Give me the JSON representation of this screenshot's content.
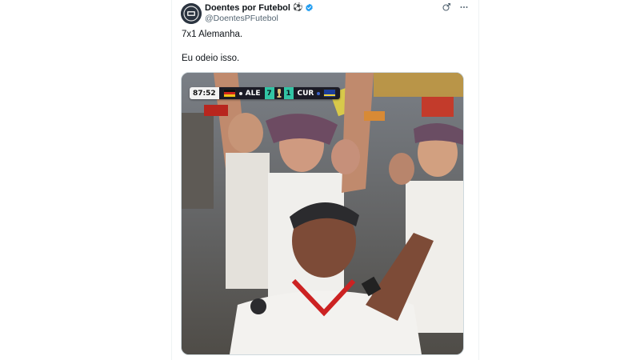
{
  "tweet": {
    "author": {
      "display_name": "Doentes por Futebol",
      "handle": "@DoentesPFutebol",
      "verified": true,
      "name_emoji": "⚽"
    },
    "text_line1": "7x1 Alemanha.",
    "text_line2": "Eu odeio isso.",
    "media": {
      "score_bug": {
        "clock": "87:52",
        "home_team": "ALE",
        "home_score": "7",
        "away_score": "1",
        "away_team": "CUR"
      }
    }
  },
  "colors": {
    "verified_blue": "#1d9bf0",
    "score_green": "#32c4a4",
    "text_primary": "#0f1419",
    "text_secondary": "#536471"
  },
  "icons": {
    "grok": "grok-icon",
    "more": "more-options-icon",
    "verified": "verified-badge-icon"
  }
}
